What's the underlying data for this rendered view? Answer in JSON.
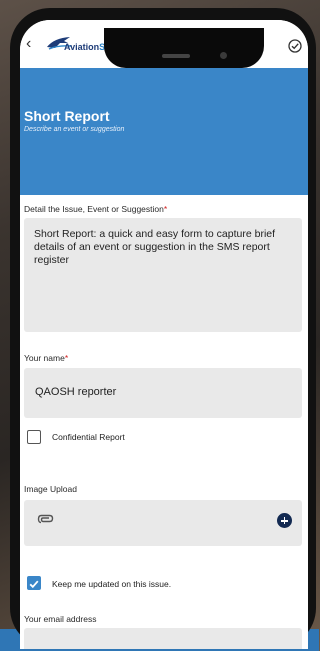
{
  "app": {
    "logo_text_main": "Aviation",
    "logo_text_accent": "SMS",
    "back_icon": "chevron-left-icon",
    "submit_icon": "check-circle-icon"
  },
  "header": {
    "title": "Short Report",
    "subtitle": "Describe an event or suggestion"
  },
  "form": {
    "issue": {
      "label": "Detail the Issue, Event or Suggestion",
      "required_mark": "*",
      "value": "Short Report: a quick and easy form to capture brief details of an event or suggestion in the SMS report register"
    },
    "name": {
      "label": "Your name",
      "required_mark": "*",
      "value": "QAOSH reporter"
    },
    "confidential": {
      "label": "Confidential Report",
      "checked": false
    },
    "image_upload": {
      "label": "Image Upload",
      "attach_icon": "paperclip-icon",
      "add_icon": "plus-circle-icon"
    },
    "keep_updated": {
      "label": "Keep me updated on this issue.",
      "checked": true
    },
    "email": {
      "label": "Your email address"
    }
  },
  "colors": {
    "header": "#3a86c8",
    "field_bg": "#e9e9e9",
    "required": "#d01b1b",
    "add_button": "#132a52"
  }
}
